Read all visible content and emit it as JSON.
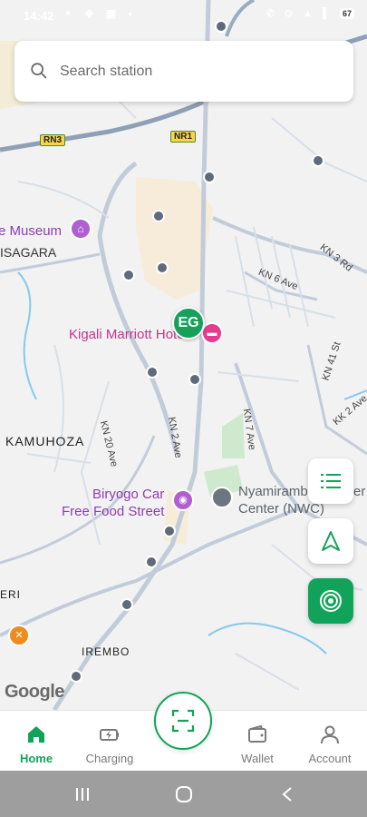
{
  "status_bar": {
    "time": "14:42",
    "left_icons": "⚬ ✥ ▣ •",
    "right_icons": "✆ ⊙ ▲ ▌",
    "battery": "67"
  },
  "search": {
    "placeholder": "Search station",
    "value": ""
  },
  "map": {
    "places": [
      {
        "id": "museum",
        "text": "e Museum"
      },
      {
        "id": "nyabugogo",
        "text": "ISAGARA"
      },
      {
        "id": "marriott",
        "text": "Kigali Marriott Hote"
      },
      {
        "id": "kamuhoza",
        "text": "KAMUHOZA"
      },
      {
        "id": "biryogo1",
        "text": "Biryogo Car"
      },
      {
        "id": "biryogo2",
        "text": "Free Food Street"
      },
      {
        "id": "nwc1",
        "text": "Nyamiramb"
      },
      {
        "id": "nwc1b",
        "text": "er"
      },
      {
        "id": "nwc2",
        "text": "Center (NWC)"
      },
      {
        "id": "eri",
        "text": "ERI"
      },
      {
        "id": "irembo",
        "text": "IREMBO"
      }
    ],
    "streets": [
      {
        "id": "kn3rd",
        "text": "KN 3 Rd"
      },
      {
        "id": "kn6",
        "text": "KN 6 Ave"
      },
      {
        "id": "kn41",
        "text": "KN 41 St"
      },
      {
        "id": "kk2",
        "text": "KK 2 Ave"
      },
      {
        "id": "kn7",
        "text": "KN 7 Ave"
      },
      {
        "id": "kn2",
        "text": "KN 2 Ave"
      },
      {
        "id": "kn20",
        "text": "KN 20 Ave"
      }
    ],
    "shields": [
      {
        "id": "rn3",
        "text": "RN3"
      },
      {
        "id": "nr1",
        "text": "NR1"
      }
    ],
    "station_marker": "EG",
    "attribution": "Google"
  },
  "fabs": {
    "list": "list-icon",
    "navigate": "navigation-arrow-icon",
    "locate": "locate-target-icon"
  },
  "bottom_nav": {
    "items": [
      {
        "label": "Home",
        "icon": "home-icon",
        "active": true
      },
      {
        "label": "Charging",
        "icon": "battery-charging-icon",
        "active": false
      },
      {
        "label": "Wallet",
        "icon": "wallet-icon",
        "active": false
      },
      {
        "label": "Account",
        "icon": "account-icon",
        "active": false
      }
    ],
    "scan_icon": "scan-icon"
  },
  "colors": {
    "accent": "#12a35a",
    "marker": "#16a05a",
    "road": "#c9d3e0",
    "highway": "#8496ad",
    "water": "#7ec6e8"
  }
}
